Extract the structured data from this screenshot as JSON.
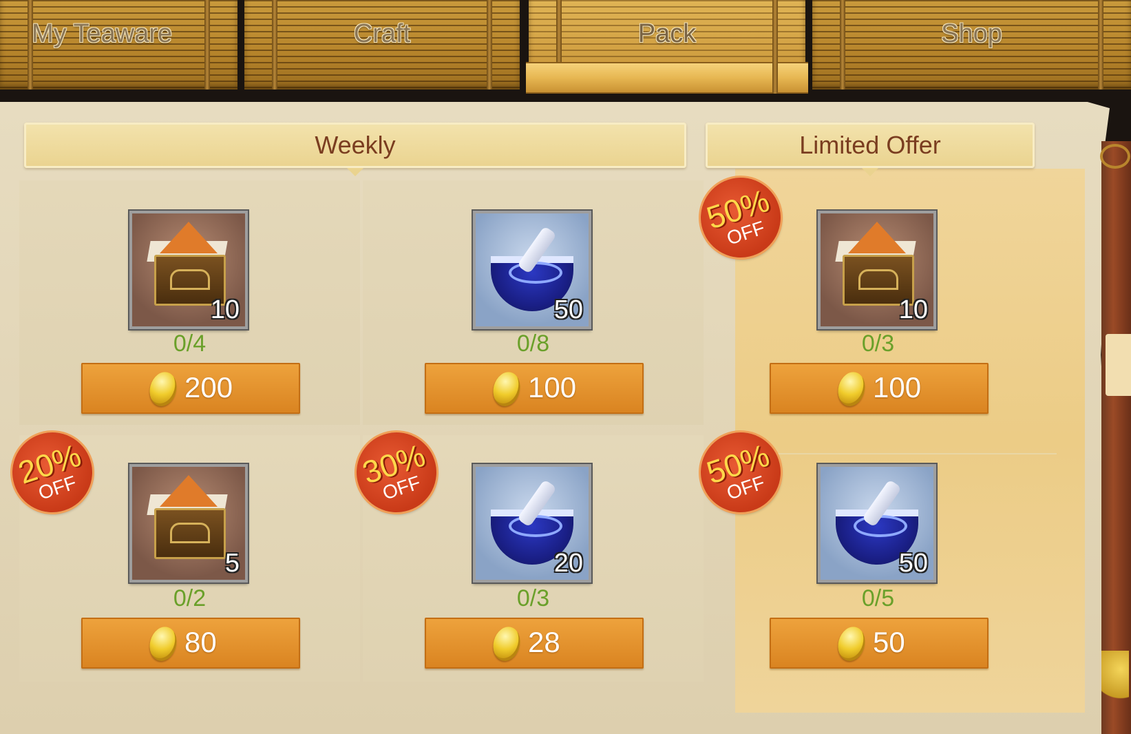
{
  "tabs": [
    {
      "label": "My Teaware",
      "active": false
    },
    {
      "label": "Craft",
      "active": false
    },
    {
      "label": "Pack",
      "active": true
    },
    {
      "label": "Shop",
      "active": false
    }
  ],
  "sections": {
    "weekly": "Weekly",
    "limited": "Limited Offer"
  },
  "items": {
    "w1": {
      "icon": "tea-box-icon",
      "count": "10",
      "limit": "0/4",
      "price": "200"
    },
    "w2": {
      "icon": "mortar-icon",
      "count": "50",
      "limit": "0/8",
      "price": "100"
    },
    "w3": {
      "icon": "tea-box-icon",
      "count": "5",
      "limit": "0/2",
      "price": "80",
      "discount": "20%",
      "off": "OFF"
    },
    "w4": {
      "icon": "mortar-icon",
      "count": "20",
      "limit": "0/3",
      "price": "28",
      "discount": "30%",
      "off": "OFF"
    },
    "l1": {
      "icon": "tea-box-icon",
      "count": "10",
      "limit": "0/3",
      "price": "100",
      "discount": "50%",
      "off": "OFF"
    },
    "l2": {
      "icon": "mortar-icon",
      "count": "50",
      "limit": "0/5",
      "price": "50",
      "discount": "50%",
      "off": "OFF"
    }
  },
  "colors": {
    "accent": "#d98320",
    "limit_text": "#6aa02a",
    "badge": "#c93a18",
    "header_text": "#7a3d20"
  }
}
